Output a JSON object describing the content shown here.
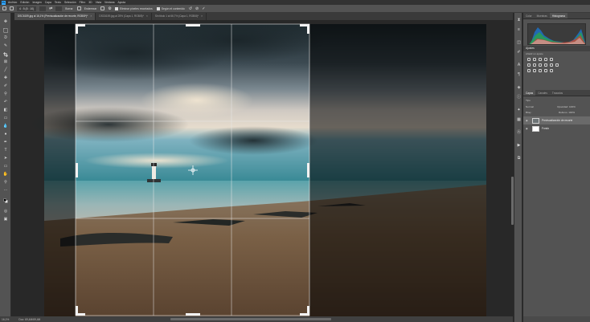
{
  "app": {
    "logo": "Ps",
    "menu": [
      "Archivo",
      "Edición",
      "Imagen",
      "Capa",
      "Texto",
      "Selección",
      "Filtro",
      "3D",
      "Vista",
      "Ventana",
      "Ayuda"
    ]
  },
  "options": {
    "ratio": "4 : 5 (8 : 10)",
    "clear": "Borrar",
    "straighten": "Enderezar",
    "delete_pixels": "Eliminar píxeles recortados",
    "content_aware": "Según el contenido",
    "cancel_glyph": "⊘",
    "commit_glyph": "✓"
  },
  "tabs": [
    {
      "label": "DSC6159.jpg al 16,1% (Previsualización de recorte, RGB/8*)*",
      "active": true
    },
    {
      "label": "DSC6159.jpg al 25% (Capa 1, RGB/8)*",
      "active": false
    },
    {
      "label": "Sin título 1 al 66,7% (Capa 1, RGB/8)*",
      "active": false
    }
  ],
  "status": {
    "zoom": "16,1%",
    "doc": "Doc: 69,4M/69,4M"
  },
  "panels": {
    "top_tabs": [
      "Color",
      "Muestras",
      "Histograma"
    ],
    "adjustments_title": "Ajustes",
    "adjustments_sub": "Añadir un ajuste",
    "layers_tabs": [
      "Capas",
      "Canales",
      "Trazados"
    ],
    "blend_mode": "Normal",
    "opacity": "Opacidad: 100%",
    "lock": "Bloq.:",
    "fill": "Relleno: 100%",
    "kind": "Tipo",
    "layers": [
      {
        "name": "Previsualización de recorte",
        "selected": true
      },
      {
        "name": "Fondo",
        "selected": false
      }
    ]
  },
  "colors": {
    "app_bg": "#282828",
    "panel_bg": "#535353",
    "accent": "#31a8ff"
  }
}
